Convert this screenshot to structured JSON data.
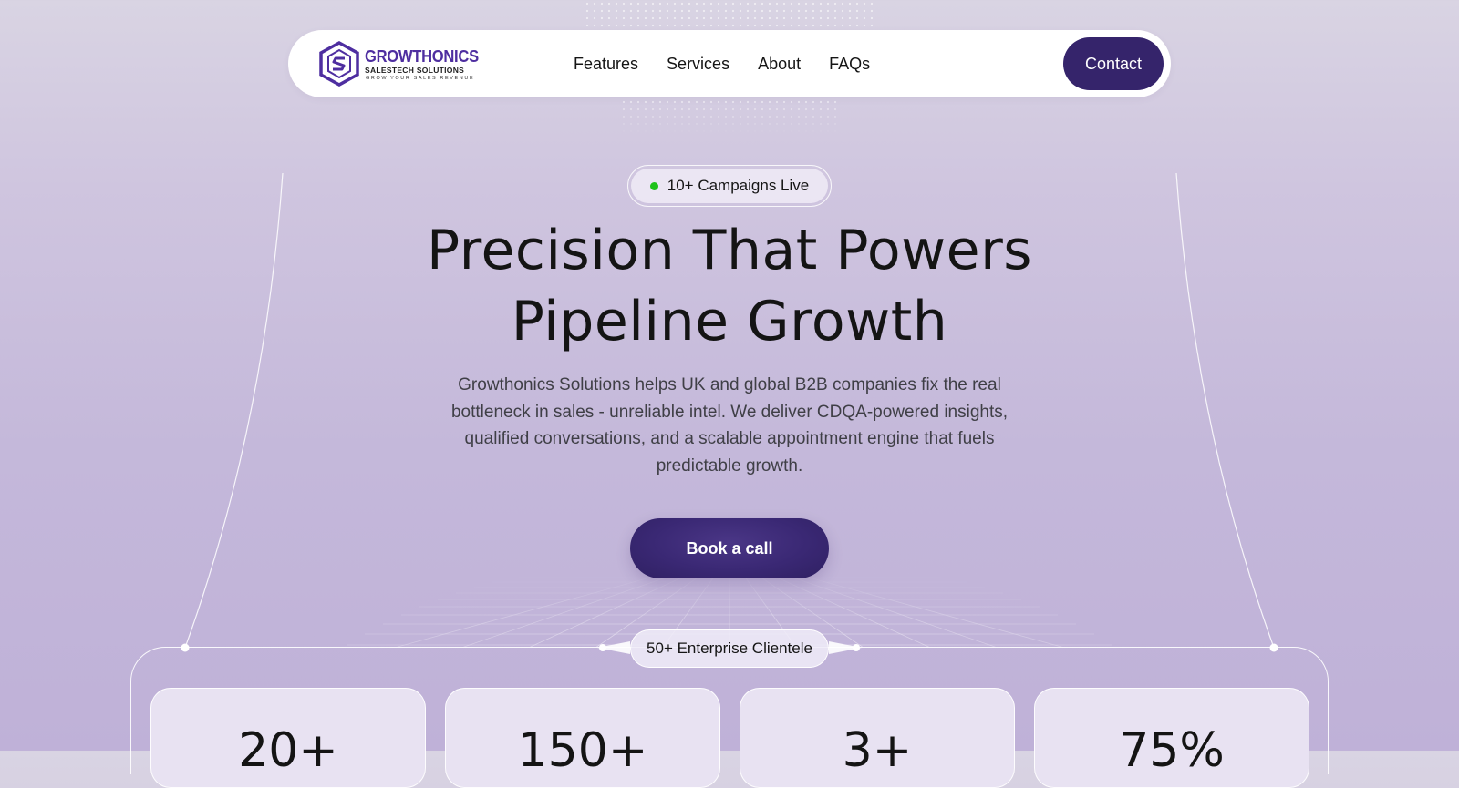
{
  "brand": {
    "name": "GROWTHONICS",
    "subtitle": "SALESTECH SOLUTIONS",
    "tagline": "GROW YOUR SALES REVENUE",
    "color": "#4e2ea0"
  },
  "nav": {
    "links": [
      "Features",
      "Services",
      "About",
      "FAQs"
    ],
    "contact_label": "Contact"
  },
  "hero": {
    "badge": "10+ Campaigns Live",
    "badge_status_color": "#1ec21a",
    "title_line1": "Precision That Powers",
    "title_line2": "Pipeline Growth",
    "description": "Growthonics Solutions helps UK and global B2B companies fix the real bottleneck in sales - unreliable intel.  We deliver CDQA-powered insights, qualified conversations, and a scalable appointment engine that fuels predictable growth.",
    "cta_label": "Book a call"
  },
  "stats": {
    "label": "50+ Enterprise Clientele",
    "values": [
      "20+",
      "150+",
      "3+",
      "75%"
    ]
  },
  "colors": {
    "accent": "#35246b",
    "background": "#c9bedc"
  }
}
